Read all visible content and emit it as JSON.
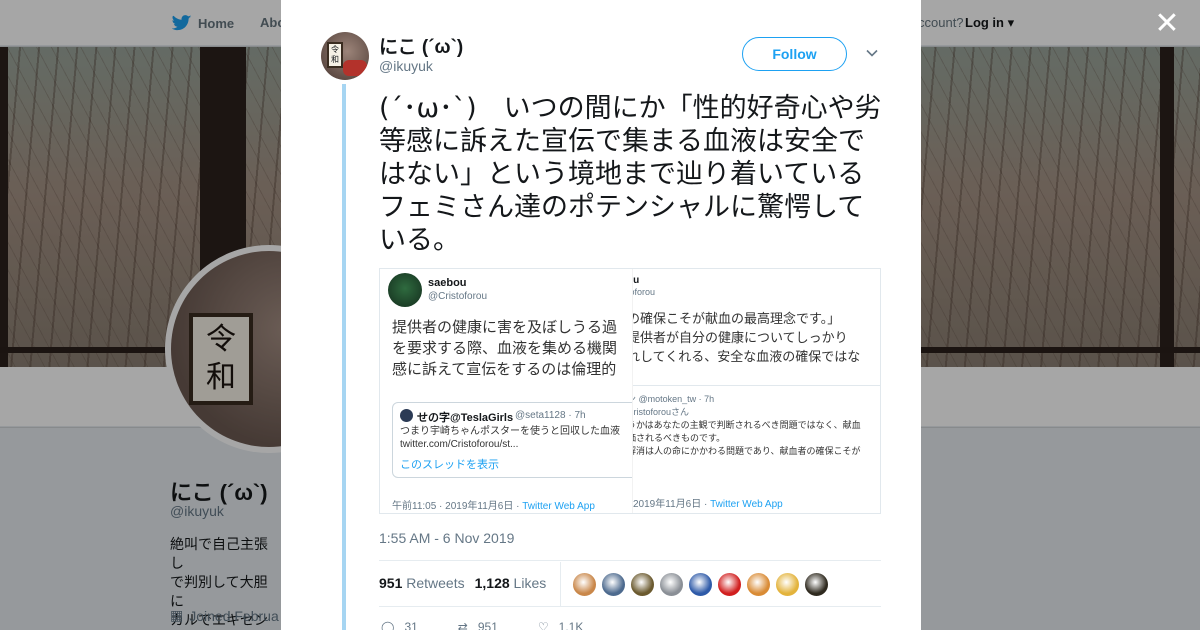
{
  "background": {
    "nav": {
      "home": "Home",
      "about": "Abo",
      "account": "ccount?",
      "login": "Log in"
    },
    "profile": {
      "name": "にこ (´ω`)",
      "handle": "@ikuyuk",
      "bio": "絶叫で自己主張し\nで判別して大胆に\nカルでエキセント",
      "joined": "Joined Februa",
      "plaque": [
        "令",
        "和"
      ]
    }
  },
  "tweet": {
    "author_name": "にこ (´ω`)",
    "author_handle": "@ikuyuk",
    "follow_label": "Follow",
    "text": "(´･ω･`)　いつの間にか「性的好奇心や劣等感に訴えた宣伝で集まる血液は安全ではない」という境地まで辿り着いているフェミさん達のポテンシャルに驚愕している。",
    "timestamp": "1:55 AM - 6 Nov 2019",
    "retweets_count": "951",
    "retweets_label": "Retweets",
    "likes_count": "1,128",
    "likes_label": "Likes",
    "actions": {
      "replies": "31",
      "retweets": "951",
      "likes": "1.1K"
    },
    "liker_colors": [
      "#c9874a",
      "#4d6a8e",
      "#6b5a2f",
      "#8a8f96",
      "#2e5aa8",
      "#d11f1f",
      "#d98b35",
      "#e3b33c",
      "#2f2a1f"
    ]
  },
  "embedded_image": {
    "left": {
      "name": "saebou",
      "handle": "@Cristoforou",
      "lines": [
        "提供者の健康に害を及ぼしうる過",
        "を要求する際、血液を集める機関",
        "感に訴えて宣伝をするのは倫理的"
      ],
      "quote_name": "せの字@TeslaGirls",
      "quote_handle": "@seta1128 · 7h",
      "quote_lines": [
        "つまり宇崎ちゃんポスターを使うと回収した血液",
        "twitter.com/Cristoforou/st..."
      ],
      "quote_link": "このスレッドを表示",
      "time": "午前11:05 · 2019年11月6日 · ",
      "app": "Twitter Web App"
    },
    "right": {
      "name": "ou",
      "handle": "toforou",
      "lines": [
        "の確保こそが献血の最高理念です。」",
        "提供者が自分の健康についてしっかり",
        "れしてくれる、安全な血液の確保ではな"
      ],
      "reply_header": "ン @motoken_tw · 7h",
      "reply_to": "Cristoforouさん",
      "reply_lines": [
        "うかはあなたの主観で判断されるべき問題ではなく、献血",
        "価されるべきものです。",
        "解消は人の命にかかわる問題であり、献血者の確保こそが"
      ],
      "time": "2019年11月6日 · ",
      "app": "Twitter Web App"
    }
  },
  "colors": {
    "accent": "#1da1f2",
    "thread": "#a6d5f2",
    "text": "#14171a",
    "muted": "#657786"
  }
}
